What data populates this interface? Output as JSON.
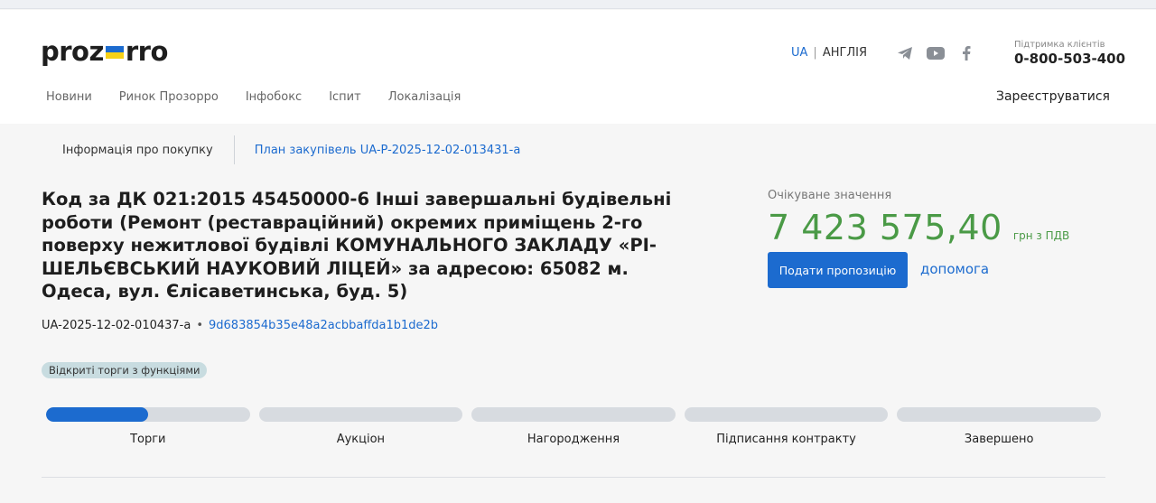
{
  "logo": {
    "part1": "proz",
    "part2": "rro",
    "flag_colors": [
      "#1c6bcf",
      "#f7d117"
    ]
  },
  "lang": {
    "current": "UA",
    "alt": "АНГЛІЯ"
  },
  "social": [
    "telegram-icon",
    "youtube-icon",
    "facebook-icon"
  ],
  "support": {
    "label": "Підтримка клієнтів",
    "phone": "0-800-503-400"
  },
  "nav": {
    "items": [
      "Новини",
      "Ринок Прозорро",
      "Інфобокс",
      "Іспит",
      "Локалізація"
    ],
    "register": "Зареєструватися"
  },
  "tabs": {
    "info": "Інформація про покупку",
    "plan": "План закупівель UA-P-2025-12-02-013431-a"
  },
  "tender": {
    "title": "Код за ДК 021:2015 45450000-6 Інші завершальні будівельні роботи (Ремонт (реставраційний) окремих приміщень 2-го поверху нежитлової будівлі КОМУНАЛЬНОГО ЗАКЛАДУ «РІ-ШЕЛЬЄВСЬКИЙ НАУКОВИЙ ЛІЦЕЙ» за адресою: 65082 м. Одеса, вул. Єлісаветинська, буд. 5)",
    "id": "UA-2025-12-02-010437-a",
    "separator": "•",
    "hash": "9d683854b35e48a2acbbaffda1b1de2b",
    "procedure": "Відкриті торги з функціями"
  },
  "expected": {
    "label": "Очікуване значення",
    "amount": "7 423 575,40",
    "currency": "грн з ПДВ"
  },
  "actions": {
    "bid": "Подати пропозицію",
    "help": "допомога"
  },
  "stages": [
    {
      "label": "Торги",
      "progress": 0.5
    },
    {
      "label": "Аукціон",
      "progress": 0
    },
    {
      "label": "Нагородження",
      "progress": 0
    },
    {
      "label": "Підписання контракту",
      "progress": 0
    },
    {
      "label": "Завершено",
      "progress": 0
    }
  ],
  "colors": {
    "accent": "#1c6bcf",
    "amount": "#4a9a46"
  }
}
